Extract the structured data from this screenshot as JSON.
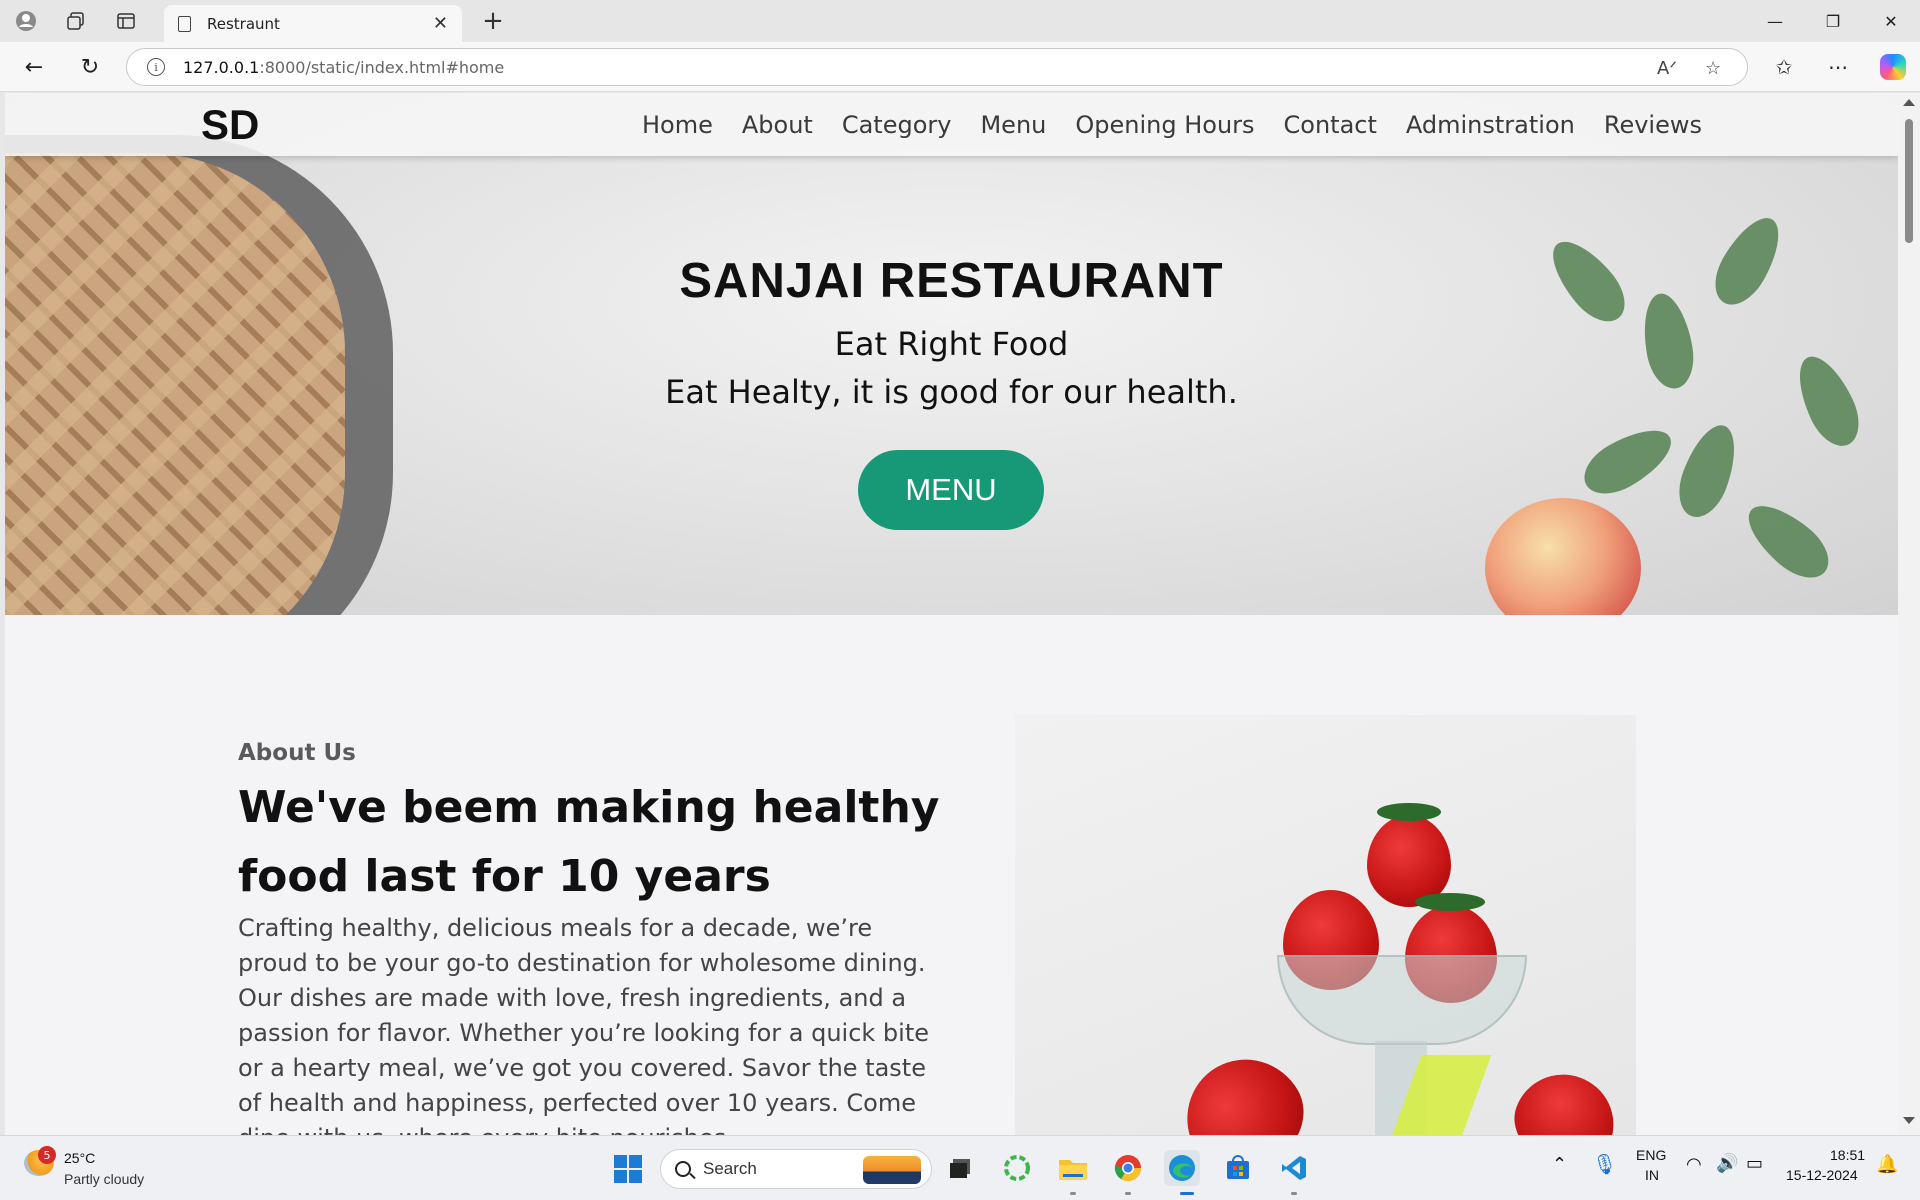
{
  "browser": {
    "tab_title": "Restraunt",
    "url_host": "127.0.0.1",
    "url_rest": ":8000/static/index.html#home",
    "window_controls": [
      "minimize-icon",
      "restore-icon",
      "close-icon"
    ]
  },
  "site": {
    "logo": "SD",
    "nav": [
      "Home",
      "About",
      "Category",
      "Menu",
      "Opening Hours",
      "Contact",
      "Adminstration",
      "Reviews"
    ],
    "hero": {
      "title": "SANJAI RESTAURANT",
      "subtitle1": "Eat Right Food",
      "subtitle2": "Eat Healty, it is good for our health.",
      "button": "MENU"
    },
    "about": {
      "label": "About Us",
      "heading": "We've beem making healthy food last for 10 years",
      "body": "Crafting healthy, delicious meals for a decade, we’re proud to be your go-to destination for wholesome dining. Our dishes are made with love, fresh ingredients, and a passion for flavor. Whether you’re looking for a quick bite or a hearty meal, we’ve got you covered. Savor the taste of health and happiness, perfected over 10 years. Come dine with us, where every bite nourishes"
    }
  },
  "taskbar": {
    "weather_badge": "5",
    "temperature": "25°C",
    "weather": "Partly cloudy",
    "search_placeholder": "Search",
    "language": "ENG",
    "region": "IN",
    "time": "18:51",
    "date": "15-12-2024"
  },
  "colors": {
    "accent_button": "#179978",
    "nav_text": "#3a3a3a"
  }
}
